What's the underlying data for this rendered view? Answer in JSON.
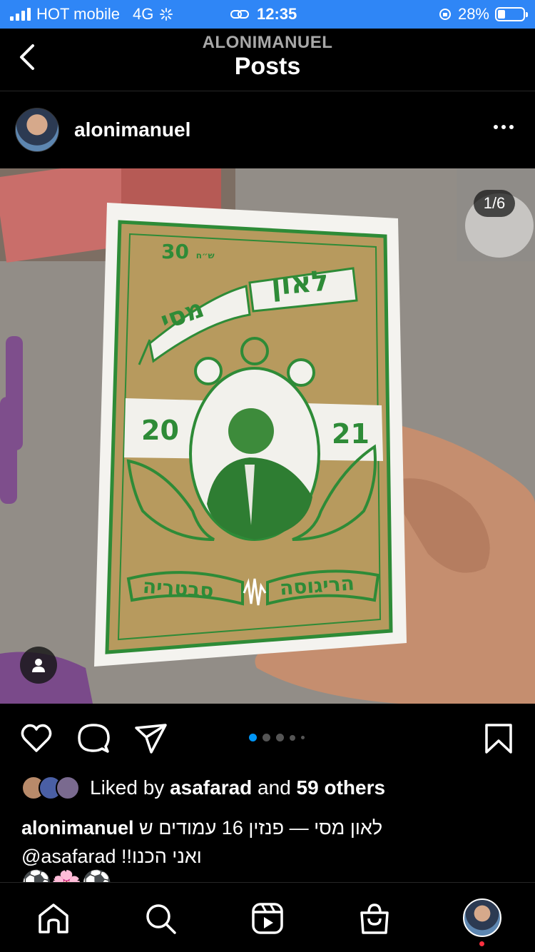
{
  "status_bar": {
    "carrier": "HOT mobile",
    "network": "4G",
    "time": "12:35",
    "battery_percent": "28%",
    "battery_level": 0.28,
    "bg_color": "#2f86f6"
  },
  "header": {
    "subtitle": "ALONIMANUEL",
    "title": "Posts",
    "back_icon": "chevron-left-icon"
  },
  "post": {
    "username": "alonimanuel",
    "more_icon": "more-horizontal-icon",
    "counter": "1/6",
    "carousel_current": 1,
    "carousel_total": 6,
    "card": {
      "price": "30",
      "price_unit": "ש״ח",
      "name_top": "לאון",
      "name_bottom": "מסי",
      "year_left": "20",
      "year_right": "21",
      "bottom_left": "סבטריה",
      "bottom_right": "הריגוסה"
    }
  },
  "actions": {
    "like_icon": "heart-icon",
    "comment_icon": "comment-icon",
    "share_icon": "paper-plane-icon",
    "save_icon": "bookmark-icon",
    "active_dot_color": "#0095f6"
  },
  "likes": {
    "prefix": "Liked by",
    "user": "asafarad",
    "middle": "and",
    "others": "59 others"
  },
  "caption": {
    "username": "alonimanuel",
    "text": "לאון מסי — פנזין 16 עמודים ש",
    "mention": "@asafarad",
    "text2": "ואני הכנו!!",
    "emojis": "⚽🌸⚽"
  },
  "tabbar": {
    "home_icon": "home-icon",
    "search_icon": "search-icon",
    "reels_icon": "reels-icon",
    "shop_icon": "shopping-bag-icon",
    "profile_icon": "profile-avatar"
  }
}
